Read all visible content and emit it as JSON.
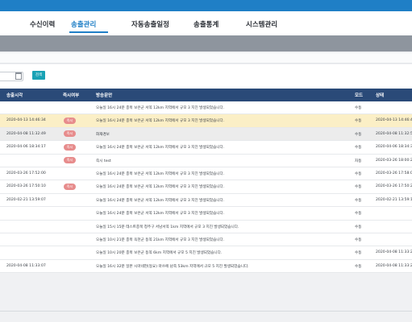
{
  "nav": {
    "items": [
      {
        "label": "수신이력",
        "active": false
      },
      {
        "label": "송출관리",
        "active": true
      },
      {
        "label": "자동송출일정",
        "active": false
      },
      {
        "label": "송출통계",
        "active": false
      },
      {
        "label": "시스템관리",
        "active": false
      }
    ]
  },
  "search": {
    "button_label": "검색"
  },
  "table": {
    "headers": [
      "송출시각",
      "즉시여부",
      "방송문안",
      "모드",
      "상태"
    ],
    "rows": [
      {
        "time": "",
        "badge": "",
        "text": "오늘일 16시 24분 충북 보은군 서쪽 12km 지역에서 규모 3 지진 발생되었습니다.",
        "mode": "수동",
        "status": "",
        "style": "normal"
      },
      {
        "time": "2020-04-13 14:46:34",
        "badge": "즉시",
        "text": "오늘일 16시 24분 충북 보은군 서쪽 12km 지역에서 규모 3 지진 발생되었습니다.",
        "mode": "수동",
        "status": "2020-04-13 14:46:47",
        "style": "hl"
      },
      {
        "time": "2020-04-08 11:32:49",
        "badge": "즉시",
        "text": "화재경보",
        "mode": "수동",
        "status": "2020-04-08 11:32:57",
        "style": "gray"
      },
      {
        "time": "2020-04-06 18:34:17",
        "badge": "즉시",
        "text": "오늘일 16시 24분 충북 보은군 서쪽 12km 지역에서 규모 3 지진 발생되었습니다.",
        "mode": "수동",
        "status": "2020-04-06 18:34:31",
        "style": "normal"
      },
      {
        "time": "",
        "badge": "즉시",
        "text": "즉시 test",
        "mode": "자동",
        "status": "2020-03-26 18:00:21",
        "style": "normal"
      },
      {
        "time": "2020-03-26 17:52:00",
        "badge": "",
        "text": "오늘일 16시 24분 충북 보은군 서쪽 12km 지역에서 규모 3 지진 발생되었습니다.",
        "mode": "수동",
        "status": "2020-03-26 17:58:06",
        "style": "normal"
      },
      {
        "time": "2020-03-26 17:50:10",
        "badge": "즉시",
        "text": "오늘일 16시 24분 충북 보은군 서쪽 12km 지역에서 규모 3 지진 발생되었습니다.",
        "mode": "수동",
        "status": "2020-03-26 17:50:25",
        "style": "normal"
      },
      {
        "time": "2020-02-21 13:59:07",
        "badge": "",
        "text": "오늘일 16시 24분 충북 보은군 서쪽 12km 지역에서 규모 3 지진 발생되었습니다.",
        "mode": "수동",
        "status": "2020-02-21 13:59:15",
        "style": "normal"
      },
      {
        "time": "",
        "badge": "",
        "text": "오늘일 16시 24분 충북 보은군 서쪽 12km 지역에서 규모 3 지진 발생되었습니다.",
        "mode": "수동",
        "status": "",
        "style": "normal"
      },
      {
        "time": "",
        "badge": "",
        "text": "오늘일 15시 15분 테스트충북 청주구 서남서쪽 1km 지역에서 규모 3 지진 발생되었습니다.",
        "mode": "수동",
        "status": "",
        "style": "normal"
      },
      {
        "time": "",
        "badge": "",
        "text": "오늘일 10시 21분 충북 옥천군 동쪽 21km 지역에서 규모 3 지진 발생되었습니다.",
        "mode": "수동",
        "status": "",
        "style": "normal"
      },
      {
        "time": "",
        "badge": "",
        "text": "오늘일 10시 20분 충북 보은군 동쪽 6km 지역에서 규모 5 지진 발생되었습니다.",
        "mode": "수동",
        "status": "2020-04-08 11:33:21",
        "style": "normal"
      },
      {
        "time": "2020-04-08 11:33:07",
        "badge": "",
        "text": "오늘일 16시 32분 일본 시마네현(동요) 마쓰에 남쪽 53km 지역에서 규모 5 지진 발생되었습니다.",
        "mode": "수동",
        "status": "2020-04-08 11:33:21",
        "style": "normal"
      }
    ]
  }
}
